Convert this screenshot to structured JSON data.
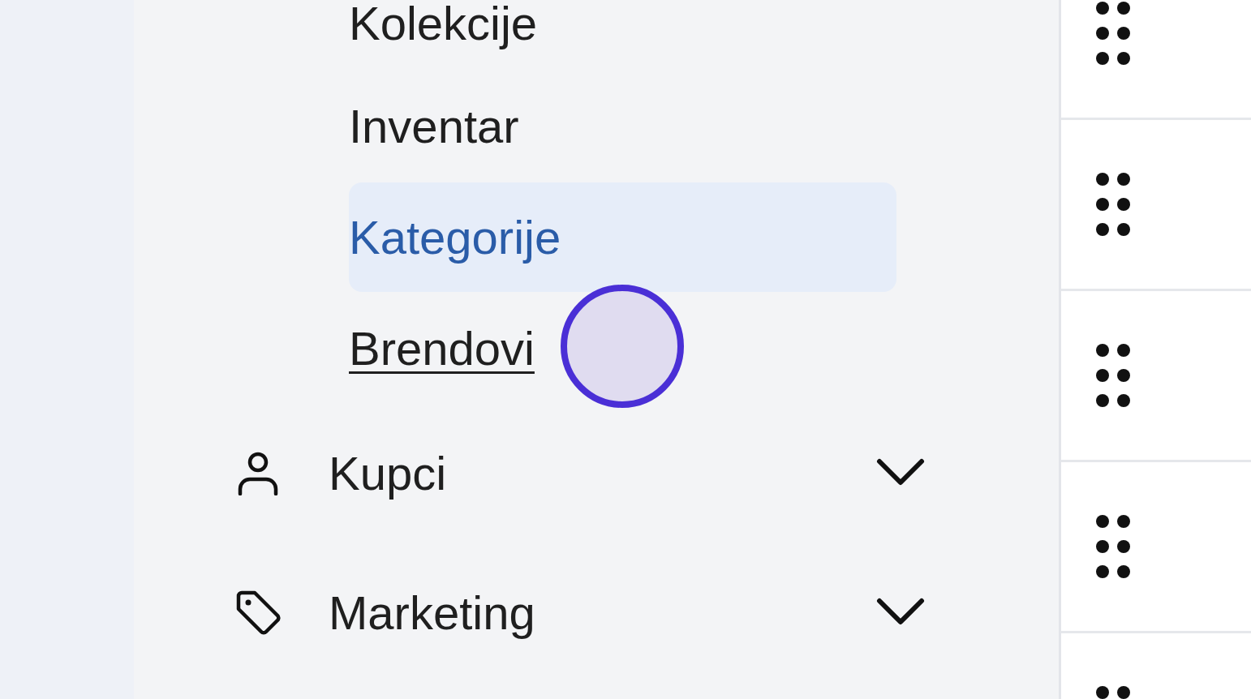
{
  "sidebar": {
    "sub_items": [
      {
        "label": "Kolekcije",
        "selected": false,
        "hovered": false
      },
      {
        "label": "Inventar",
        "selected": false,
        "hovered": false
      },
      {
        "label": "Kategorije",
        "selected": true,
        "hovered": false
      },
      {
        "label": "Brendovi",
        "selected": false,
        "hovered": true
      }
    ],
    "items": [
      {
        "label": "Kupci",
        "kind": "person",
        "expanded": false
      },
      {
        "label": "Marketing",
        "kind": "tag",
        "expanded": false
      }
    ]
  }
}
